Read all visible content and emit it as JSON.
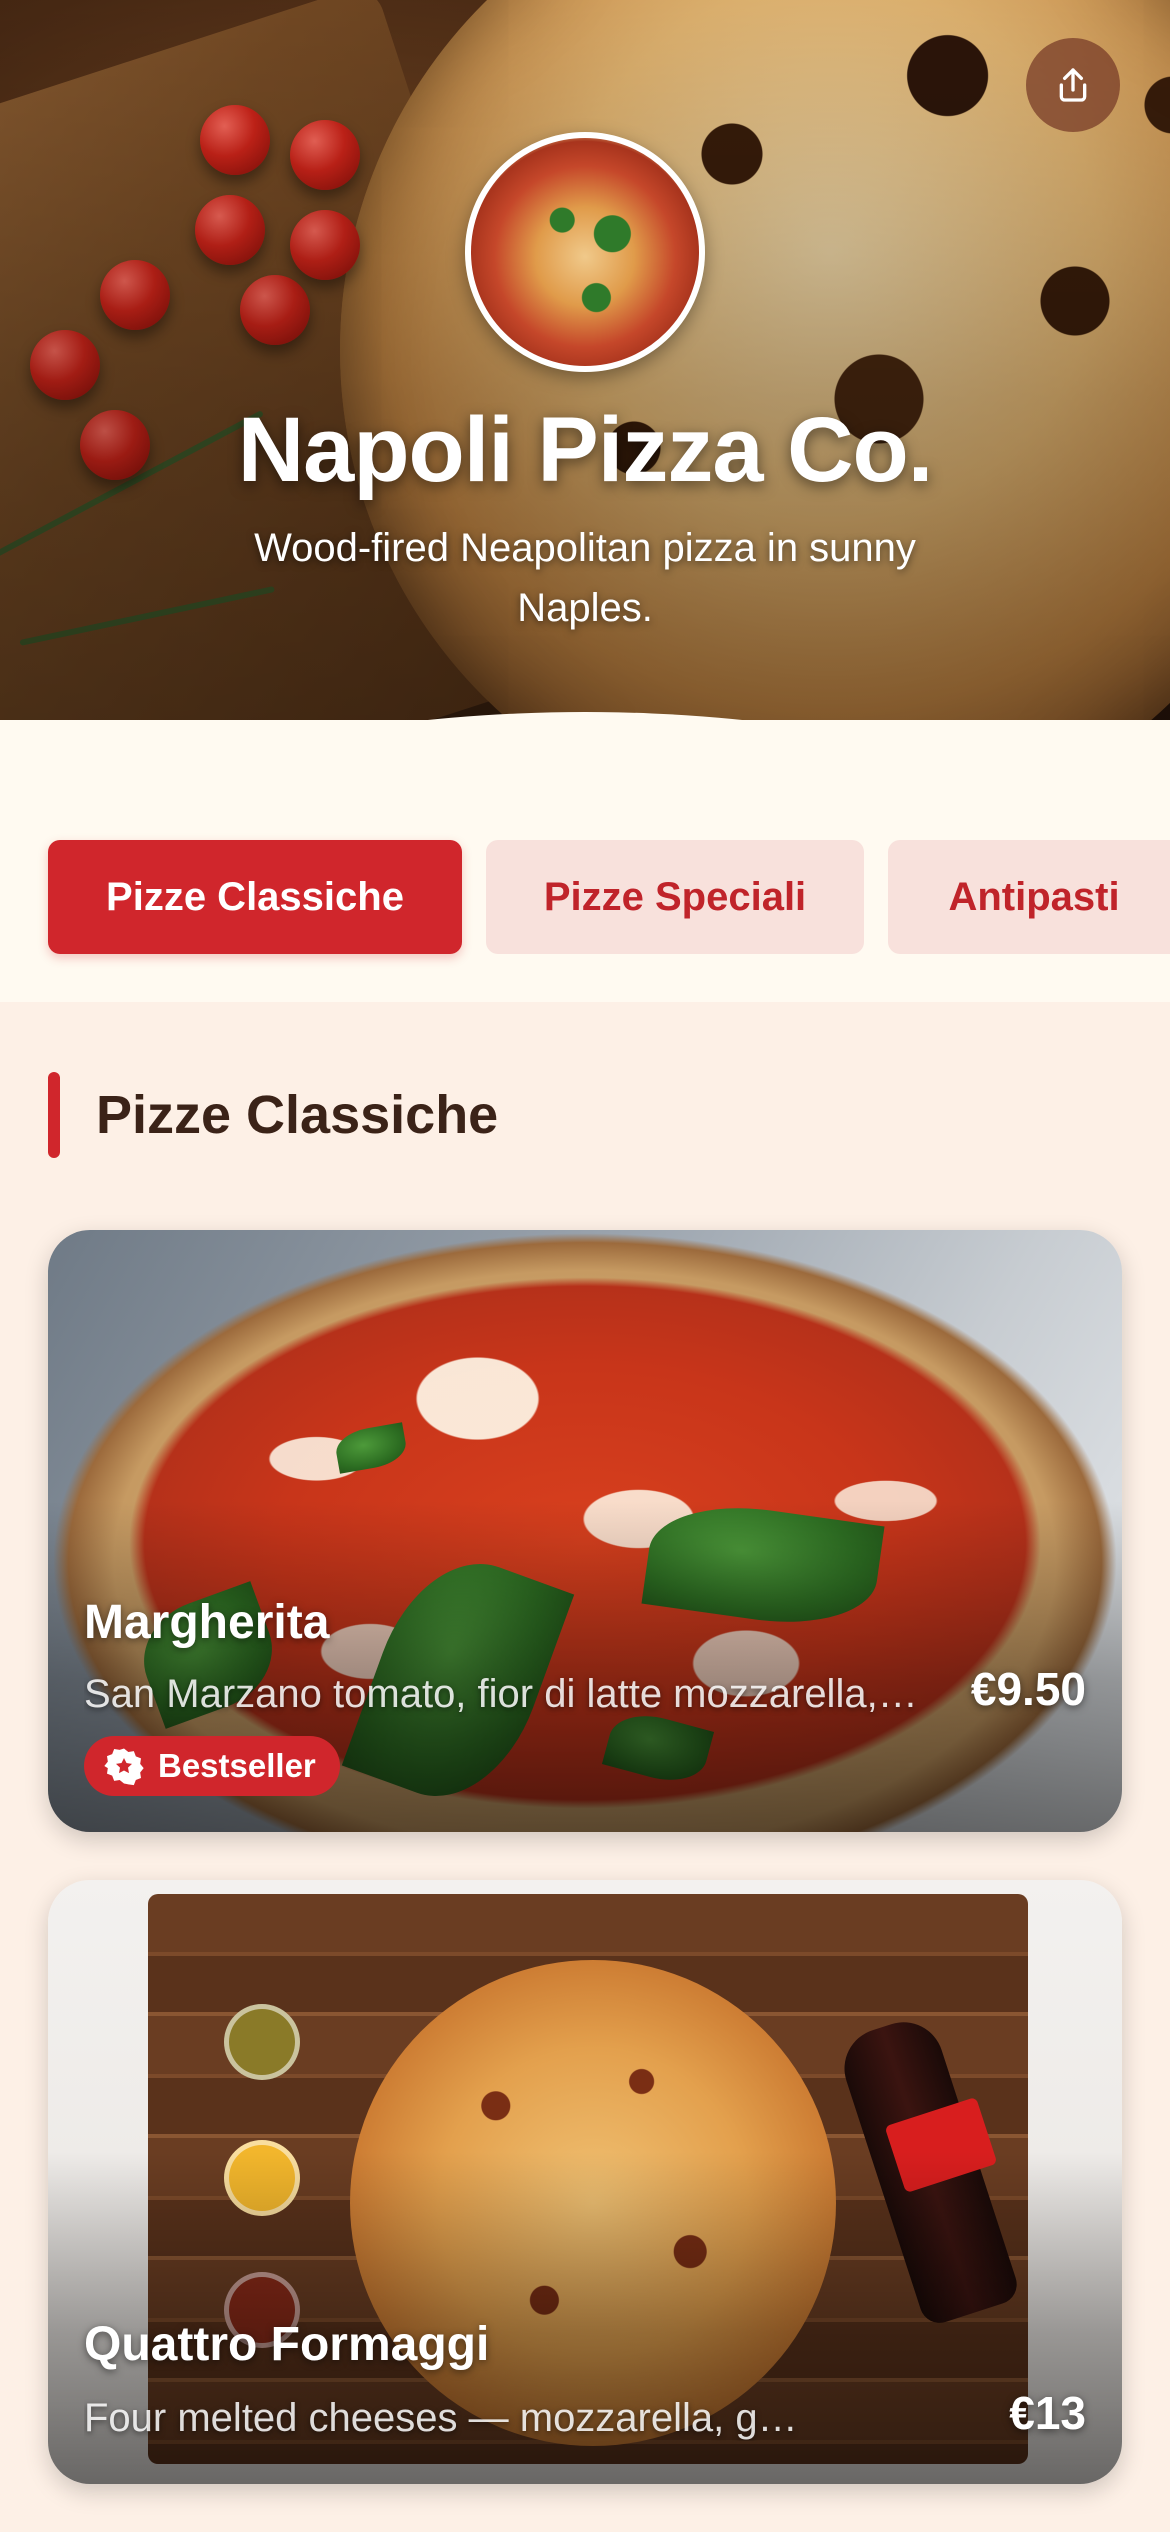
{
  "header": {
    "brand_name": "Napoli Pizza Co.",
    "tagline": "Wood-fired Neapolitan pizza in sunny Naples.",
    "share_icon": "share-icon"
  },
  "categories": {
    "tabs": [
      {
        "label": "Pizze Classiche",
        "active": true
      },
      {
        "label": "Pizze Speciali",
        "active": false
      },
      {
        "label": "Antipasti",
        "active": false
      }
    ]
  },
  "section": {
    "title": "Pizze Classiche"
  },
  "menu_items": [
    {
      "name": "Margherita",
      "description": "San Marzano tomato, fior di latte mozzarella, fresh basil",
      "price": "€9.50",
      "badge": "Bestseller",
      "badge_icon": "star-badge-icon"
    },
    {
      "name": "Quattro Formaggi",
      "description": "Four melted cheeses — mozzarella, gorgonzola, parmigiano, fontina",
      "price": "€13"
    }
  ],
  "colors": {
    "accent": "#d0262c",
    "tab_idle_bg": "#f8e1dc",
    "page_bg": "#fdf0e6",
    "heading": "#3b2318"
  }
}
